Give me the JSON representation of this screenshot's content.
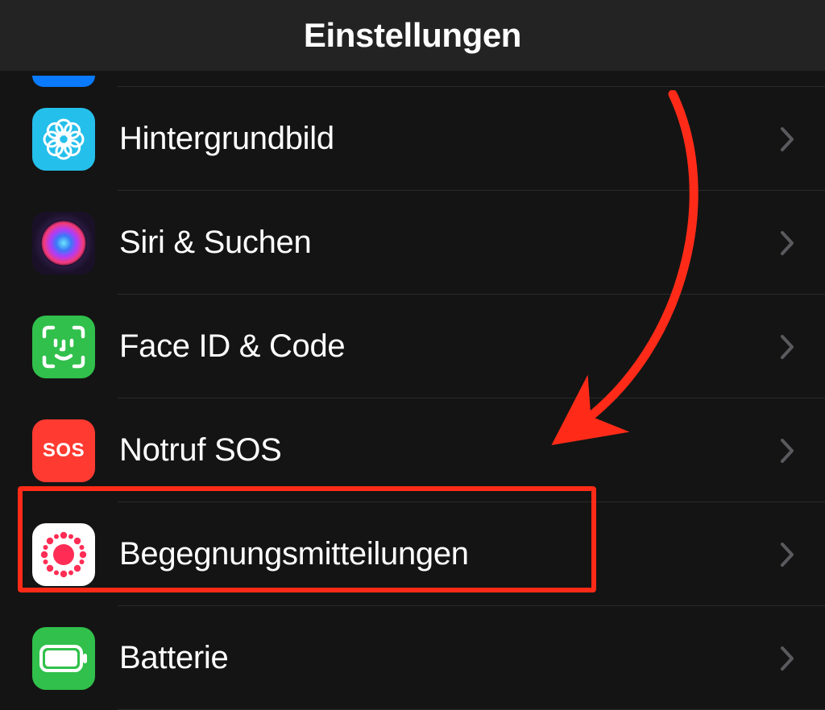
{
  "header": {
    "title": "Einstellungen"
  },
  "rows": [
    {
      "id": "wallpaper",
      "label": "Hintergrundbild",
      "icon": "wallpaper-icon"
    },
    {
      "id": "siri",
      "label": "Siri & Suchen",
      "icon": "siri-icon"
    },
    {
      "id": "faceid",
      "label": "Face ID & Code",
      "icon": "faceid-icon"
    },
    {
      "id": "sos",
      "label": "Notruf SOS",
      "icon": "sos-icon",
      "icon_text": "SOS"
    },
    {
      "id": "exposure",
      "label": "Begegnungsmitteilungen",
      "icon": "exposure-icon",
      "highlighted": true
    },
    {
      "id": "battery",
      "label": "Batterie",
      "icon": "battery-icon"
    }
  ],
  "annotation": {
    "type": "arrow-and-box",
    "target_row": "exposure",
    "color": "#ff2b18"
  }
}
